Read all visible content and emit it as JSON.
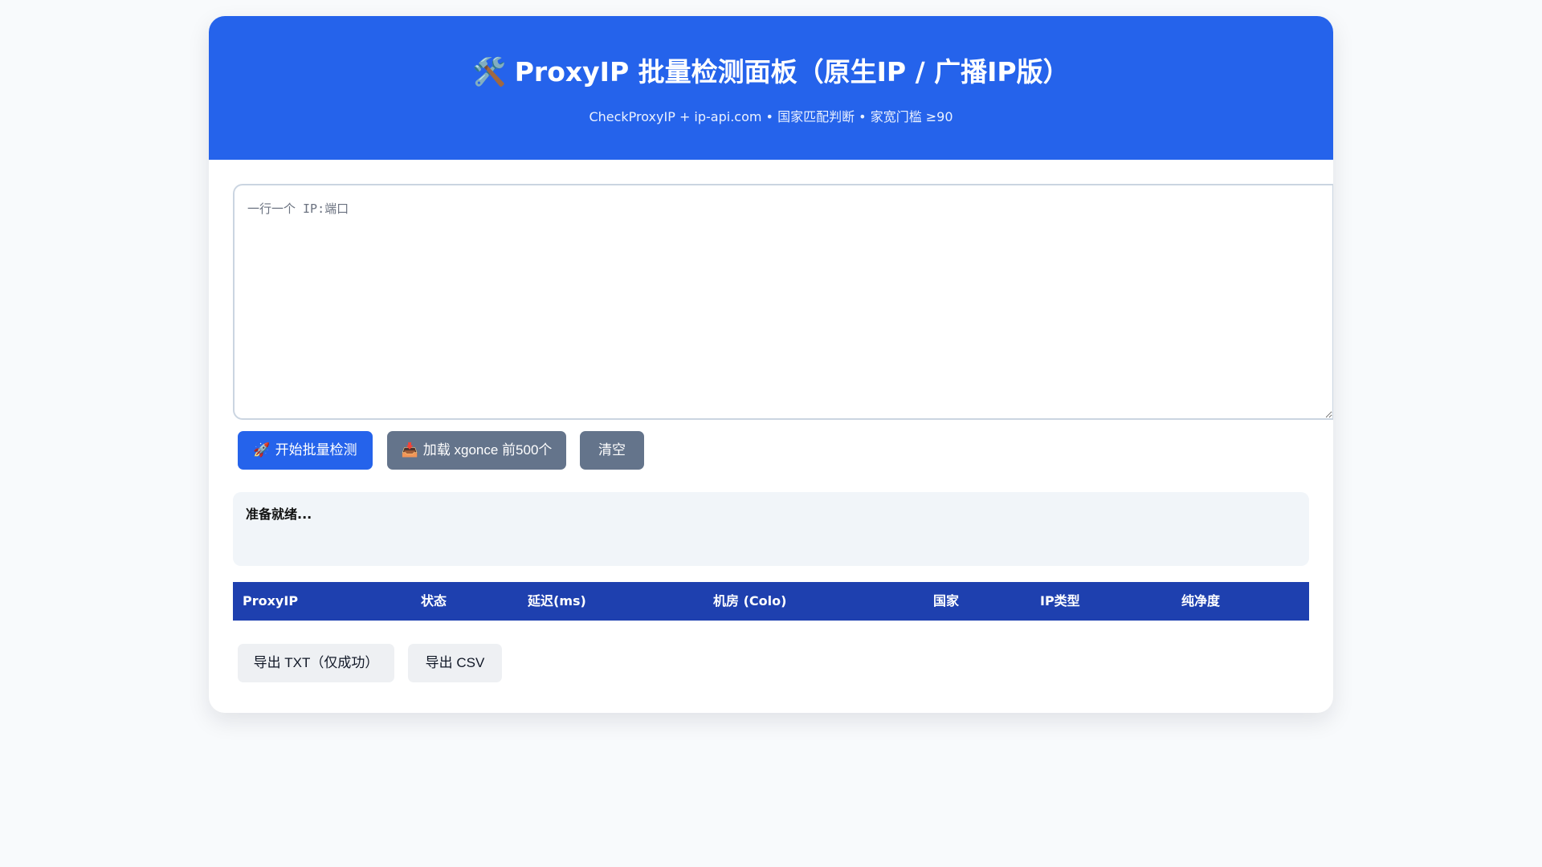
{
  "header": {
    "icon": "🛠️",
    "title": "ProxyIP 批量检测面板（原生IP / 广播IP版）",
    "subtitle": "CheckProxyIP + ip-api.com • 国家匹配判断 • 家宽门槛 ≥90"
  },
  "input": {
    "placeholder": "一行一个 IP:端口",
    "value": ""
  },
  "actions": {
    "start": {
      "icon": "🚀",
      "label": "开始批量检测"
    },
    "load": {
      "icon": "📥",
      "label": "加载 xgonce 前500个"
    },
    "clear": {
      "label": "清空"
    }
  },
  "status": {
    "text": "准备就绪..."
  },
  "table": {
    "columns": [
      "ProxyIP",
      "状态",
      "延迟(ms)",
      "机房 (Colo)",
      "国家",
      "IP类型",
      "纯净度"
    ],
    "rows": []
  },
  "export": {
    "txt": "导出 TXT（仅成功）",
    "csv": "导出 CSV"
  },
  "colors": {
    "primary": "#2563eb",
    "table_header": "#1e40af",
    "secondary": "#64748b",
    "status_bg": "#f1f5f9"
  }
}
